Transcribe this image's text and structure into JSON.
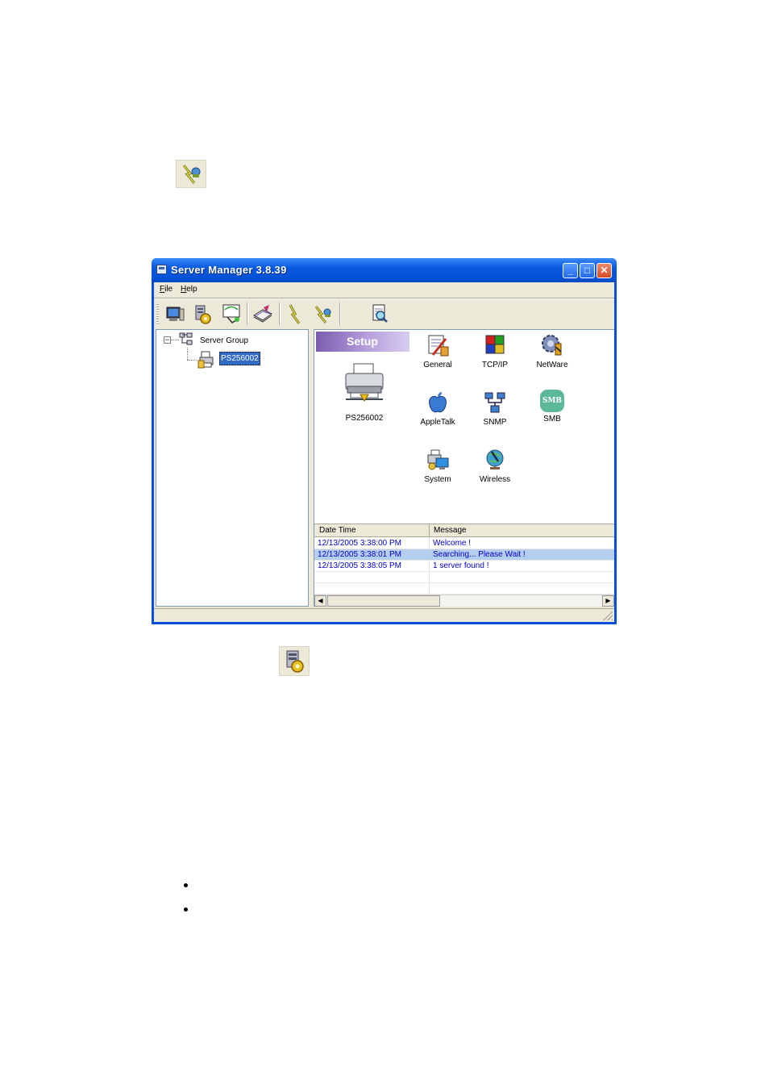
{
  "window": {
    "title": "Server Manager 3.8.39",
    "minimize_label": "_",
    "maximize_label": "□",
    "close_label": "✕"
  },
  "menu": [
    {
      "label": "File",
      "key": "F",
      "rest": "ile"
    },
    {
      "label": "Help",
      "key": "H",
      "rest": "elp"
    }
  ],
  "tree": {
    "root_label": "Server Group",
    "expander": "−",
    "child_label": "PS256002"
  },
  "setup": {
    "banner": "Setup",
    "printer_label": "PS256002",
    "icons": [
      {
        "label": "General",
        "icon": "general-icon"
      },
      {
        "label": "TCP/IP",
        "icon": "tcpip-icon"
      },
      {
        "label": "NetWare",
        "icon": "netware-icon"
      },
      {
        "label": "AppleTalk",
        "icon": "appletalk-icon"
      },
      {
        "label": "SNMP",
        "icon": "snmp-icon"
      },
      {
        "label": "SMB",
        "icon": "smb-icon",
        "badge": "SMB"
      },
      {
        "label": "System",
        "icon": "system-icon"
      },
      {
        "label": "Wireless",
        "icon": "wireless-icon"
      }
    ]
  },
  "log": {
    "columns": [
      "Date Time",
      "Message"
    ],
    "rows": [
      {
        "time": "12/13/2005 3:38:00 PM",
        "message": "Welcome !",
        "selected": false
      },
      {
        "time": "12/13/2005 3:38:01 PM",
        "message": "Searching... Please Wait !",
        "selected": true
      },
      {
        "time": "12/13/2005 3:38:05 PM",
        "message": "1 server found !",
        "selected": false
      }
    ]
  },
  "colors": {
    "titlebar": "#0552d4",
    "log_text": "#0000c8",
    "selection": "#b5cdef",
    "setup_banner": "#b59fdc"
  }
}
